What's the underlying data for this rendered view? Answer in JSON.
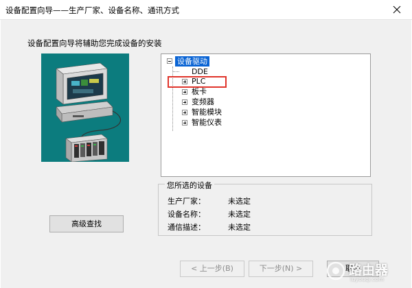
{
  "window": {
    "title": "设备配置向导——生产厂家、设备名称、通讯方式"
  },
  "intro_text": "设备配置向导将辅助您完成设备的安装",
  "tree": {
    "root": "设备驱动",
    "items": [
      {
        "label": "DDE",
        "expandable": false
      },
      {
        "label": "PLC",
        "expandable": true,
        "highlighted": true
      },
      {
        "label": "板卡",
        "expandable": true
      },
      {
        "label": "变频器",
        "expandable": true
      },
      {
        "label": "智能模块",
        "expandable": true
      },
      {
        "label": "智能仪表",
        "expandable": true
      }
    ]
  },
  "selected_device": {
    "legend": "您所选的设备",
    "rows": [
      {
        "label": "生产厂家：",
        "value": "未选定"
      },
      {
        "label": "设备名称：",
        "value": "未选定"
      },
      {
        "label": "通信描述：",
        "value": "未选定"
      }
    ]
  },
  "buttons": {
    "advanced_search": "高级查找",
    "prev": "< 上一步(B)",
    "next": "下一步(N) >",
    "cancel": "取消"
  },
  "watermark": {
    "text": "路由器",
    "url": "luyouqi.com"
  },
  "colors": {
    "tree_selection": "#0a64d4",
    "highlight_box": "#e0332a",
    "illustration_bg": "#0c7c7e"
  }
}
